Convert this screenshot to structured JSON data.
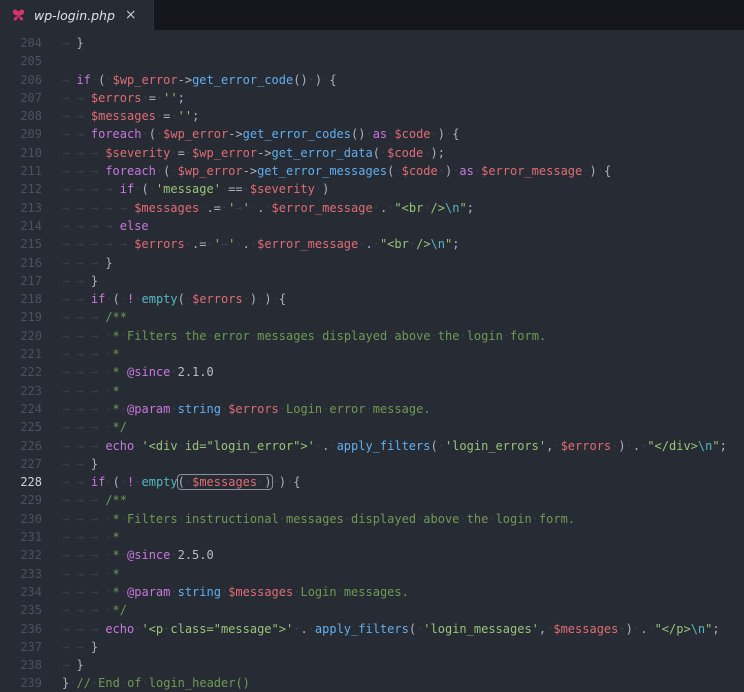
{
  "tab": {
    "filename": "wp-login.php",
    "close": "×"
  },
  "theme": {
    "bg": "#272b33",
    "tabbar-bg": "#15171c",
    "tab-fg": "#e0e3e8",
    "gutter": "#4a5160",
    "gutter-active": "#ced3db",
    "punct": "#abb2bf",
    "keyword": "#c678dd",
    "function": "#61afef",
    "builtin": "#56b6c2",
    "variable": "#e06c75",
    "string": "#98c379",
    "escape": "#56b6c2",
    "comment": "#6f9954",
    "doc-tag": "#c678dd",
    "doc-type": "#61afef",
    "doc-var": "#e06c75",
    "number": "#b6bdc9",
    "ws": "#3a4049",
    "match-border": "#8a919e",
    "icon": "#d6336c"
  },
  "editor": {
    "active_line": 228,
    "lines": [
      {
        "num": 204,
        "indent": 1,
        "tokens": [
          [
            "p",
            "}"
          ]
        ]
      },
      {
        "num": 205,
        "indent": 0,
        "tokens": []
      },
      {
        "num": 206,
        "indent": 1,
        "tokens": [
          [
            "k",
            "if"
          ],
          [
            "p",
            " ( "
          ],
          [
            "v",
            "$wp_error"
          ],
          [
            "p",
            "->"
          ],
          [
            "f",
            "get_error_code"
          ],
          [
            "p",
            "() ) {"
          ]
        ]
      },
      {
        "num": 207,
        "indent": 2,
        "tokens": [
          [
            "v",
            "$errors"
          ],
          [
            "p",
            " = "
          ],
          [
            "s",
            "''"
          ],
          [
            "p",
            ";"
          ]
        ]
      },
      {
        "num": 208,
        "indent": 2,
        "tokens": [
          [
            "v",
            "$messages"
          ],
          [
            "p",
            " = "
          ],
          [
            "s",
            "''"
          ],
          [
            "p",
            ";"
          ]
        ]
      },
      {
        "num": 209,
        "indent": 2,
        "tokens": [
          [
            "k",
            "foreach"
          ],
          [
            "p",
            " ( "
          ],
          [
            "v",
            "$wp_error"
          ],
          [
            "p",
            "->"
          ],
          [
            "f",
            "get_error_codes"
          ],
          [
            "p",
            "() "
          ],
          [
            "k",
            "as"
          ],
          [
            "p",
            " "
          ],
          [
            "v",
            "$code"
          ],
          [
            "p",
            " ) {"
          ]
        ]
      },
      {
        "num": 210,
        "indent": 3,
        "tokens": [
          [
            "v",
            "$severity"
          ],
          [
            "p",
            " = "
          ],
          [
            "v",
            "$wp_error"
          ],
          [
            "p",
            "->"
          ],
          [
            "f",
            "get_error_data"
          ],
          [
            "p",
            "( "
          ],
          [
            "v",
            "$code"
          ],
          [
            "p",
            " );"
          ]
        ]
      },
      {
        "num": 211,
        "indent": 3,
        "tokens": [
          [
            "k",
            "foreach"
          ],
          [
            "p",
            " ( "
          ],
          [
            "v",
            "$wp_error"
          ],
          [
            "p",
            "->"
          ],
          [
            "f",
            "get_error_messages"
          ],
          [
            "p",
            "( "
          ],
          [
            "v",
            "$code"
          ],
          [
            "p",
            " ) "
          ],
          [
            "k",
            "as"
          ],
          [
            "p",
            " "
          ],
          [
            "v",
            "$error_message"
          ],
          [
            "p",
            " ) {"
          ]
        ]
      },
      {
        "num": 212,
        "indent": 4,
        "tokens": [
          [
            "k",
            "if"
          ],
          [
            "p",
            " ( "
          ],
          [
            "s",
            "'message'"
          ],
          [
            "p",
            " == "
          ],
          [
            "v",
            "$severity"
          ],
          [
            "p",
            " )"
          ]
        ]
      },
      {
        "num": 213,
        "indent": 5,
        "tokens": [
          [
            "v",
            "$messages"
          ],
          [
            "p",
            " .= "
          ],
          [
            "s",
            "'\t'"
          ],
          [
            "p",
            " . "
          ],
          [
            "v",
            "$error_message"
          ],
          [
            "p",
            " . "
          ],
          [
            "s",
            "\"<br />"
          ],
          [
            "e",
            "\\n"
          ],
          [
            "s",
            "\""
          ],
          [
            "p",
            ";"
          ]
        ]
      },
      {
        "num": 214,
        "indent": 4,
        "tokens": [
          [
            "k",
            "else"
          ]
        ]
      },
      {
        "num": 215,
        "indent": 5,
        "tokens": [
          [
            "v",
            "$errors"
          ],
          [
            "p",
            " .= "
          ],
          [
            "s",
            "'\t'"
          ],
          [
            "p",
            " . "
          ],
          [
            "v",
            "$error_message"
          ],
          [
            "p",
            " . "
          ],
          [
            "s",
            "\"<br />"
          ],
          [
            "e",
            "\\n"
          ],
          [
            "s",
            "\""
          ],
          [
            "p",
            ";"
          ]
        ]
      },
      {
        "num": 216,
        "indent": 3,
        "tokens": [
          [
            "p",
            "}"
          ]
        ]
      },
      {
        "num": 217,
        "indent": 2,
        "tokens": [
          [
            "p",
            "}"
          ]
        ]
      },
      {
        "num": 218,
        "indent": 2,
        "tokens": [
          [
            "k",
            "if"
          ],
          [
            "p",
            " ( "
          ],
          [
            "k",
            "!"
          ],
          [
            "p",
            " "
          ],
          [
            "b",
            "empty"
          ],
          [
            "p",
            "( "
          ],
          [
            "v",
            "$errors"
          ],
          [
            "p",
            " ) ) {"
          ]
        ]
      },
      {
        "num": 219,
        "indent": 3,
        "tokens": [
          [
            "c",
            "/**"
          ]
        ]
      },
      {
        "num": 220,
        "indent": 3,
        "tokens": [
          [
            "c",
            " * Filters the error messages displayed above the login form."
          ]
        ]
      },
      {
        "num": 221,
        "indent": 3,
        "tokens": [
          [
            "c",
            " *"
          ]
        ]
      },
      {
        "num": 222,
        "indent": 3,
        "tokens": [
          [
            "c",
            " * "
          ],
          [
            "ct",
            "@since"
          ],
          [
            "c",
            " "
          ],
          [
            "n",
            "2.1.0"
          ]
        ]
      },
      {
        "num": 223,
        "indent": 3,
        "tokens": [
          [
            "c",
            " *"
          ]
        ]
      },
      {
        "num": 224,
        "indent": 3,
        "tokens": [
          [
            "c",
            " * "
          ],
          [
            "ct",
            "@param"
          ],
          [
            "c",
            " "
          ],
          [
            "cy",
            "string"
          ],
          [
            "c",
            " "
          ],
          [
            "cv",
            "$errors"
          ],
          [
            "c",
            " Login error message."
          ]
        ]
      },
      {
        "num": 225,
        "indent": 3,
        "tokens": [
          [
            "c",
            " */"
          ]
        ]
      },
      {
        "num": 226,
        "indent": 3,
        "tokens": [
          [
            "k",
            "echo"
          ],
          [
            "p",
            " "
          ],
          [
            "s",
            "'<div id=\"login_error\">'"
          ],
          [
            "p",
            " . "
          ],
          [
            "f",
            "apply_filters"
          ],
          [
            "p",
            "( "
          ],
          [
            "s",
            "'login_errors'"
          ],
          [
            "p",
            ", "
          ],
          [
            "v",
            "$errors"
          ],
          [
            "p",
            " ) . "
          ],
          [
            "s",
            "\"</div>"
          ],
          [
            "e",
            "\\n"
          ],
          [
            "s",
            "\""
          ],
          [
            "p",
            ";"
          ]
        ]
      },
      {
        "num": 227,
        "indent": 2,
        "tokens": [
          [
            "p",
            "}"
          ]
        ]
      },
      {
        "num": 228,
        "indent": 2,
        "tokens": [
          [
            "k",
            "if"
          ],
          [
            "p",
            " ( "
          ],
          [
            "k",
            "!"
          ],
          [
            "p",
            " "
          ],
          [
            "b",
            "empty"
          ],
          [
            "p",
            "( ",
            true
          ],
          [
            "v",
            "$messages",
            true
          ],
          [
            "p",
            " )",
            true
          ],
          [
            "p",
            " ) {"
          ]
        ]
      },
      {
        "num": 229,
        "indent": 3,
        "tokens": [
          [
            "c",
            "/**"
          ]
        ]
      },
      {
        "num": 230,
        "indent": 3,
        "tokens": [
          [
            "c",
            " * Filters instructional messages displayed above the login form."
          ]
        ]
      },
      {
        "num": 231,
        "indent": 3,
        "tokens": [
          [
            "c",
            " *"
          ]
        ]
      },
      {
        "num": 232,
        "indent": 3,
        "tokens": [
          [
            "c",
            " * "
          ],
          [
            "ct",
            "@since"
          ],
          [
            "c",
            " "
          ],
          [
            "n",
            "2.5.0"
          ]
        ]
      },
      {
        "num": 233,
        "indent": 3,
        "tokens": [
          [
            "c",
            " *"
          ]
        ]
      },
      {
        "num": 234,
        "indent": 3,
        "tokens": [
          [
            "c",
            " * "
          ],
          [
            "ct",
            "@param"
          ],
          [
            "c",
            " "
          ],
          [
            "cy",
            "string"
          ],
          [
            "c",
            " "
          ],
          [
            "cv",
            "$messages"
          ],
          [
            "c",
            " Login messages."
          ]
        ]
      },
      {
        "num": 235,
        "indent": 3,
        "tokens": [
          [
            "c",
            " */"
          ]
        ]
      },
      {
        "num": 236,
        "indent": 3,
        "tokens": [
          [
            "k",
            "echo"
          ],
          [
            "p",
            " "
          ],
          [
            "s",
            "'<p class=\"message\">'"
          ],
          [
            "p",
            " . "
          ],
          [
            "f",
            "apply_filters"
          ],
          [
            "p",
            "( "
          ],
          [
            "s",
            "'login_messages'"
          ],
          [
            "p",
            ", "
          ],
          [
            "v",
            "$messages"
          ],
          [
            "p",
            " ) . "
          ],
          [
            "s",
            "\"</p>"
          ],
          [
            "e",
            "\\n"
          ],
          [
            "s",
            "\""
          ],
          [
            "p",
            ";"
          ]
        ]
      },
      {
        "num": 237,
        "indent": 2,
        "tokens": [
          [
            "p",
            "}"
          ]
        ]
      },
      {
        "num": 238,
        "indent": 1,
        "tokens": [
          [
            "p",
            "}"
          ]
        ]
      },
      {
        "num": 239,
        "indent": 0,
        "tokens": [
          [
            "p",
            "} "
          ],
          [
            "c",
            "// End of login_header()"
          ]
        ]
      }
    ]
  }
}
